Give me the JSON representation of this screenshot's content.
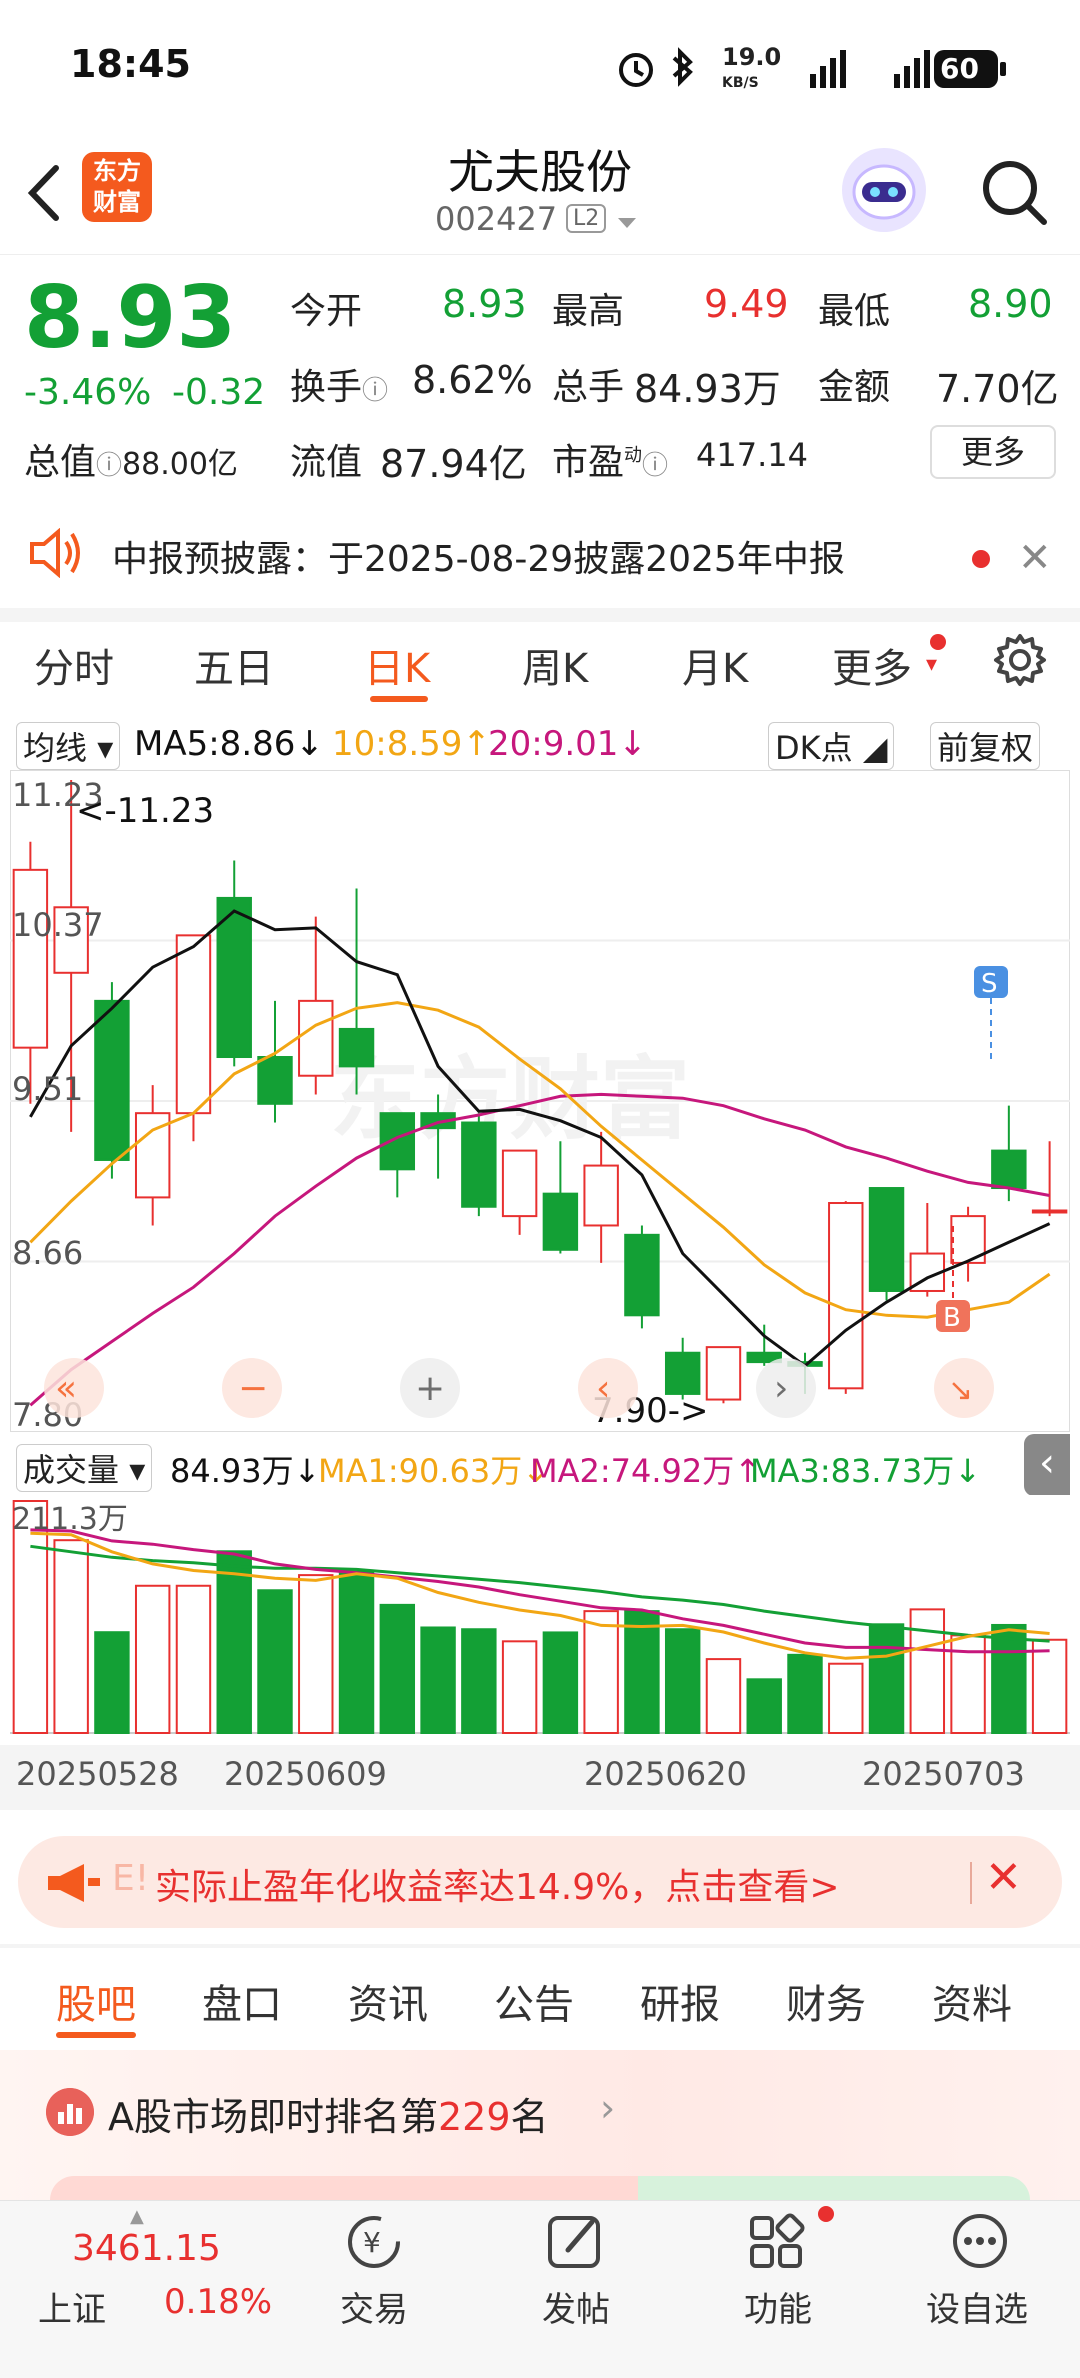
{
  "status_bar": {
    "time": "18:45",
    "net_speed": "19.0",
    "net_unit": "KB/S",
    "battery": "60"
  },
  "header": {
    "logo_line1": "东方",
    "logo_line2": "财富",
    "title": "尤夫股份",
    "code": "002427",
    "level": "L2"
  },
  "quote": {
    "price": "8.93",
    "change_pct": "-3.46%",
    "change": "-0.32",
    "open_label": "今开",
    "open": "8.93",
    "high_label": "最高",
    "high": "9.49",
    "low_label": "最低",
    "low": "8.90",
    "turnover_label": "换手",
    "turnover": "8.62%",
    "volume_label": "总手",
    "volume": "84.93万",
    "amount_label": "金额",
    "amount": "7.70亿",
    "mktcap_label": "总值",
    "mktcap": "88.00亿",
    "float_label": "流值",
    "float": "87.94亿",
    "pe_label": "市盈",
    "pe_sup": "动",
    "pe": "417.14",
    "more": "更多"
  },
  "notice": {
    "text": "中报预披露：于2025-08-29披露2025年中报"
  },
  "tabs": [
    "分时",
    "五日",
    "日K",
    "周K",
    "月K",
    "更多"
  ],
  "ma_bar": {
    "type": "均线",
    "ma5": "MA5:8.86↓",
    "ma10": "10:8.59↑",
    "ma20": "20:9.01↓",
    "dk": "DK点",
    "adjust": "前复权"
  },
  "chart_labels": {
    "y1": "11.23",
    "y2": "10.37",
    "y3": "9.51",
    "y4": "8.66",
    "y5": "7.80",
    "high_note": "<-11.23",
    "low_note": "7.90->",
    "s_mark": "S",
    "b_mark": "B"
  },
  "vol_bar": {
    "label": "成交量",
    "vol": "84.93万↓",
    "ma1": "MA1:90.63万↓",
    "ma2": "MA2:74.92万↑",
    "ma3": "MA3:83.73万↓",
    "axis_max": "211.3万"
  },
  "dates": [
    "20250528",
    "20250609",
    "20250620",
    "20250703"
  ],
  "promo": {
    "text": "实际止盈年化收益率达14.9%，点击查看>"
  },
  "bottom_tabs": [
    "股吧",
    "盘口",
    "资讯",
    "公告",
    "研报",
    "财务",
    "资料"
  ],
  "rank": {
    "prefix": "A股市场即时排名第",
    "number": "229",
    "suffix": "名"
  },
  "nav": {
    "index_value": "3461.15",
    "index_name": "上证",
    "index_pct": "0.18%",
    "trade": "交易",
    "post": "发帖",
    "function": "功能",
    "watchlist": "设自选"
  },
  "colors": {
    "up": "#e8302f",
    "down": "#13a035",
    "accent": "#f45a1e",
    "ma5": "#111111",
    "ma10": "#f2a614",
    "ma20": "#c6177c"
  },
  "chart_data": {
    "type": "candlestick",
    "ylim": [
      7.8,
      11.23
    ],
    "candles": [
      {
        "o": 9.8,
        "c": 10.75,
        "h": 10.9,
        "l": 9.5
      },
      {
        "o": 10.2,
        "c": 10.55,
        "h": 11.23,
        "l": 9.35
      },
      {
        "o": 10.05,
        "c": 9.2,
        "h": 10.15,
        "l": 9.1
      },
      {
        "o": 9.0,
        "c": 9.45,
        "h": 9.6,
        "l": 8.85
      },
      {
        "o": 9.45,
        "c": 10.4,
        "h": 10.4,
        "l": 9.3
      },
      {
        "o": 10.6,
        "c": 9.75,
        "h": 10.8,
        "l": 9.7
      },
      {
        "o": 9.75,
        "c": 9.5,
        "h": 10.05,
        "l": 9.4
      },
      {
        "o": 9.65,
        "c": 10.05,
        "h": 10.5,
        "l": 9.55
      },
      {
        "o": 9.9,
        "c": 9.7,
        "h": 10.65,
        "l": 9.55
      },
      {
        "o": 9.45,
        "c": 9.15,
        "h": 9.45,
        "l": 9.0
      },
      {
        "o": 9.45,
        "c": 9.37,
        "h": 9.55,
        "l": 9.1
      },
      {
        "o": 9.4,
        "c": 8.95,
        "h": 9.45,
        "l": 8.9
      },
      {
        "o": 8.9,
        "c": 9.25,
        "h": 9.25,
        "l": 8.8
      },
      {
        "o": 9.02,
        "c": 8.72,
        "h": 9.3,
        "l": 8.7
      },
      {
        "o": 8.85,
        "c": 9.17,
        "h": 9.35,
        "l": 8.65
      },
      {
        "o": 8.8,
        "c": 8.37,
        "h": 8.85,
        "l": 8.3
      },
      {
        "o": 8.17,
        "c": 7.95,
        "h": 8.25,
        "l": 7.92
      },
      {
        "o": 7.92,
        "c": 8.2,
        "h": 8.2,
        "l": 7.9
      },
      {
        "o": 8.17,
        "c": 8.12,
        "h": 8.32,
        "l": 8.1
      },
      {
        "o": 8.12,
        "c": 8.1,
        "h": 8.17,
        "l": 7.95
      },
      {
        "o": 7.98,
        "c": 8.97,
        "h": 8.98,
        "l": 7.95
      },
      {
        "o": 9.05,
        "c": 8.5,
        "h": 9.05,
        "l": 8.45
      },
      {
        "o": 8.5,
        "c": 8.7,
        "h": 8.97,
        "l": 8.47
      },
      {
        "o": 8.65,
        "c": 8.9,
        "h": 8.95,
        "l": 8.55
      },
      {
        "o": 9.25,
        "c": 9.05,
        "h": 9.49,
        "l": 8.98
      },
      {
        "o": 8.93,
        "c": 8.93,
        "h": 9.3,
        "l": 8.9
      }
    ],
    "ma5": [
      9.43,
      9.81,
      10.01,
      10.23,
      10.34,
      10.53,
      10.43,
      10.44,
      10.26,
      10.19,
      9.7,
      9.46,
      9.47,
      9.41,
      9.32,
      9.12,
      8.7,
      8.48,
      8.26,
      8.1,
      8.29,
      8.44,
      8.57,
      8.66,
      8.76,
      8.86
    ],
    "ma10": [
      8.76,
      8.98,
      9.18,
      9.36,
      9.45,
      9.66,
      9.77,
      9.92,
      10.01,
      10.04,
      10.0,
      9.91,
      9.74,
      9.58,
      9.38,
      9.2,
      9.02,
      8.84,
      8.64,
      8.49,
      8.4,
      8.37,
      8.36,
      8.4,
      8.44,
      8.59
    ],
    "ma20": [
      7.89,
      8.08,
      8.23,
      8.38,
      8.52,
      8.7,
      8.9,
      9.06,
      9.21,
      9.32,
      9.4,
      9.44,
      9.49,
      9.54,
      9.55,
      9.54,
      9.53,
      9.49,
      9.42,
      9.36,
      9.27,
      9.21,
      9.14,
      9.08,
      9.05,
      9.01
    ],
    "volume_ymax": 211.3,
    "volumes": [
      211.3,
      175.6,
      91.8,
      134.1,
      134.1,
      165.5,
      130.0,
      143.8,
      147.0,
      116.7,
      96.1,
      94.5,
      83.5,
      91.6,
      111.0,
      111.0,
      94.5,
      67.3,
      48.9,
      71.2,
      63.1,
      99.0,
      112.6,
      88.9,
      98.4,
      84.93
    ],
    "vol_ma1": [
      182.0,
      180.5,
      165.0,
      154.0,
      148.0,
      145.0,
      141.0,
      139.0,
      145.0,
      141.0,
      128.0,
      119.0,
      112.0,
      107.0,
      98.0,
      97.0,
      98.0,
      92.0,
      82.0,
      73.0,
      68.0,
      70.0,
      79.0,
      88.0,
      94.0,
      90.63
    ],
    "vol_ma2": [
      185.0,
      184.0,
      175.0,
      172.0,
      167.0,
      163.0,
      154.0,
      149.0,
      146.0,
      142.0,
      138.0,
      133.0,
      126.0,
      120.0,
      114.0,
      112.0,
      104.0,
      98.0,
      90.0,
      82.0,
      78.0,
      78.0,
      76.0,
      74.0,
      74.0,
      74.92
    ],
    "vol_ma3": [
      170.0,
      165.0,
      160.0,
      157.0,
      155.0,
      152.0,
      150.0,
      150.0,
      149.0,
      146.0,
      143.0,
      140.0,
      137.0,
      133.0,
      129.0,
      124.0,
      121.0,
      117.0,
      111.0,
      106.0,
      101.0,
      97.0,
      93.0,
      89.0,
      86.0,
      83.73
    ]
  }
}
